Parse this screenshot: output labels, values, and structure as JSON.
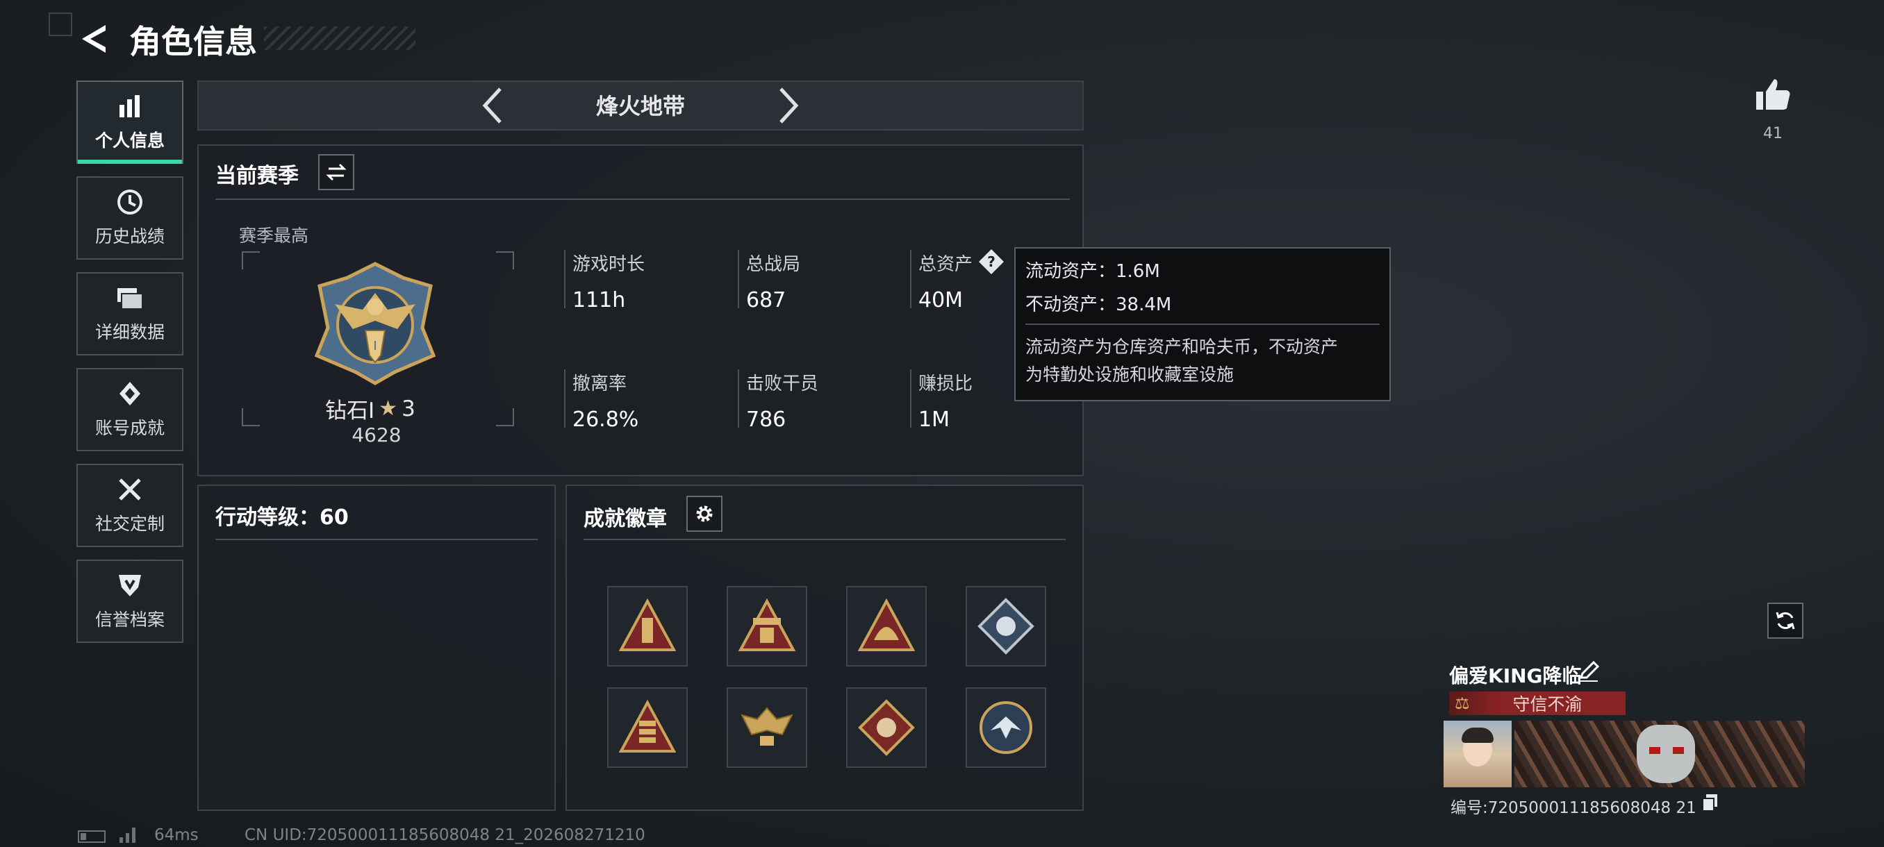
{
  "header": {
    "title": "角色信息"
  },
  "sidebar": {
    "items": [
      {
        "label": "个人信息",
        "icon": "bar-chart-icon",
        "active": true
      },
      {
        "label": "历史战绩",
        "icon": "clock-icon"
      },
      {
        "label": "详细数据",
        "icon": "folders-icon"
      },
      {
        "label": "账号成就",
        "icon": "achievement-icon"
      },
      {
        "label": "社交定制",
        "icon": "tools-icon"
      },
      {
        "label": "信誉档案",
        "icon": "shield-icon"
      }
    ]
  },
  "mode_selector": {
    "label": "烽火地带"
  },
  "season": {
    "title": "当前赛季",
    "best_label": "赛季最高",
    "rank_name": "钻石Ⅰ",
    "rank_stars": "3",
    "rank_score": "4628",
    "stats": [
      {
        "label": "游戏时长",
        "value": "111h"
      },
      {
        "label": "总战局",
        "value": "687"
      },
      {
        "label": "总资产",
        "value": "40M"
      },
      {
        "label": "撤离率",
        "value": "26.8%"
      },
      {
        "label": "击败干员",
        "value": "786"
      },
      {
        "label": "赚损比",
        "value": "1M"
      }
    ]
  },
  "tooltip": {
    "line1": "流动资产：1.6M",
    "line2": "不动资产：38.4M",
    "desc1": "流动资产为仓库资产和哈夫币，不动资产",
    "desc2": "为特勤处设施和收藏室设施"
  },
  "action_level": {
    "label": "行动等级：60"
  },
  "badges": {
    "title": "成就徽章",
    "items": [
      "badge-1",
      "badge-2",
      "badge-3",
      "badge-4",
      "badge-5",
      "badge-6",
      "badge-7",
      "badge-8"
    ]
  },
  "likes": {
    "count": "41"
  },
  "profile": {
    "name": "偏爱KING降临",
    "tag": "守信不渝",
    "id_label": "编号:720500011185608048 21"
  },
  "footer": {
    "ping": "64ms",
    "uid": "CN UID:720500011185608048 21_202608271210"
  },
  "colors": {
    "accent": "#3dd6a5",
    "tag_bg": "#8a2323",
    "gold": "#c9a45a"
  }
}
